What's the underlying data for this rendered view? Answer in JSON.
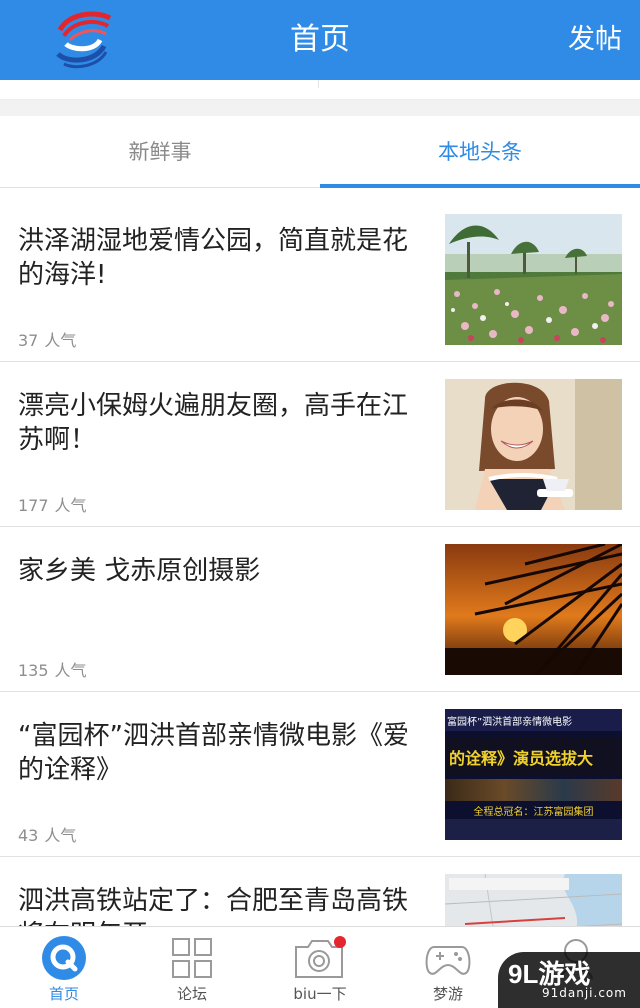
{
  "header": {
    "title": "首页",
    "post_label": "发帖",
    "accent": "#2f8be6",
    "logo_icon": "ribbon-s-logo"
  },
  "tabs": [
    {
      "label": "新鲜事",
      "active": false
    },
    {
      "label": "本地头条",
      "active": true
    }
  ],
  "articles": [
    {
      "title": "洪泽湖湿地爱情公园，简直就是花的海洋!",
      "views": "37",
      "views_unit": "人气",
      "thumb": "flower-field-photo"
    },
    {
      "title": "漂亮小保姆火遍朋友圈，高手在江苏啊！",
      "views": "177",
      "views_unit": "人气",
      "thumb": "smiling-maid-photo"
    },
    {
      "title": "家乡美  戈赤原创摄影",
      "views": "135",
      "views_unit": "人气",
      "thumb": "sunset-palm-photo"
    },
    {
      "title": "“富园杯”泗洪首部亲情微电影《爱的诠释》",
      "views": "43",
      "views_unit": "人气",
      "thumb": "film-poster-image",
      "thumb_text": {
        "top": "富园杯”泗洪首部亲情微电影",
        "middle": "的诠释》演员选拔大",
        "bottom": "全程总冠名：江苏富园集团"
      }
    },
    {
      "title": "泗洪高铁站定了：合肥至青岛高铁将在明年开",
      "views": "",
      "views_unit": "",
      "thumb": "railway-map-image"
    }
  ],
  "bottom_nav": [
    {
      "label": "首页",
      "icon": "home-q-icon",
      "active": true
    },
    {
      "label": "论坛",
      "icon": "grid-icon",
      "active": false
    },
    {
      "label": "biu一下",
      "icon": "camera-icon",
      "active": false
    },
    {
      "label": "梦游",
      "icon": "gamepad-icon",
      "active": false
    },
    {
      "label": "",
      "icon": "profile-icon",
      "active": false
    }
  ],
  "watermark": {
    "main": "9L游戏",
    "sub": "91danji.com"
  }
}
